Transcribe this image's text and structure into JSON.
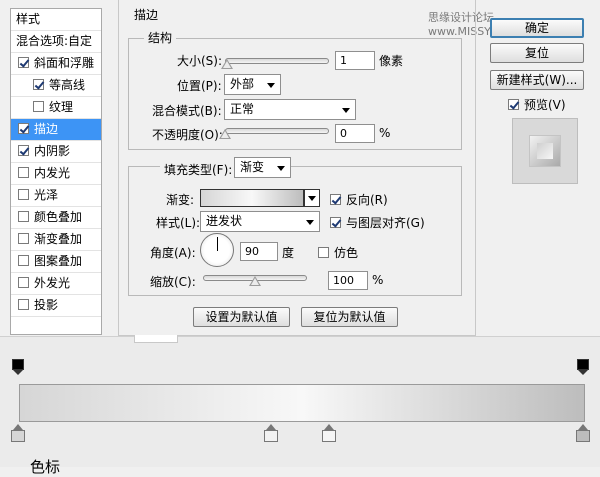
{
  "watermark": "思缘设计论坛 www.MISSYUAN.COM",
  "style_list": {
    "header": "样式",
    "blend_options": "混合选项:自定",
    "items": [
      {
        "label": "斜面和浮雕",
        "checked": true
      },
      {
        "label": "等高线",
        "checked": true
      },
      {
        "label": "纹理",
        "checked": false
      },
      {
        "label": "描边",
        "checked": true
      },
      {
        "label": "内阴影",
        "checked": true
      },
      {
        "label": "内发光",
        "checked": false
      },
      {
        "label": "光泽",
        "checked": false
      },
      {
        "label": "颜色叠加",
        "checked": false
      },
      {
        "label": "渐变叠加",
        "checked": false
      },
      {
        "label": "图案叠加",
        "checked": false
      },
      {
        "label": "外发光",
        "checked": false
      },
      {
        "label": "投影",
        "checked": false
      }
    ]
  },
  "stroke": {
    "title": "描边",
    "structure": {
      "title": "结构",
      "size_label": "大小(S):",
      "size_value": "1",
      "size_unit": "像素",
      "size_level": 0.02,
      "position_label": "位置(P):",
      "position_value": "外部",
      "blend_label": "混合模式(B):",
      "blend_value": "正常",
      "opacity_label": "不透明度(O):",
      "opacity_value": "0",
      "opacity_unit": "%",
      "opacity_level": 0.0
    },
    "fill": {
      "type_label": "填充类型(F):",
      "type_value": "渐变",
      "gradient_label": "渐变:",
      "reverse_label": "反向(R)",
      "reverse_checked": true,
      "style_label": "样式(L):",
      "style_value": "迸发状",
      "align_label": "与图层对齐(G)",
      "align_checked": true,
      "angle_label": "角度(A):",
      "angle_value": "90",
      "angle_unit": "度",
      "dither_label": "仿色",
      "dither_checked": false,
      "scale_label": "缩放(C):",
      "scale_value": "100",
      "scale_unit": "%",
      "scale_level": 0.5
    },
    "make_default": "设置为默认值",
    "reset_default": "复位为默认值"
  },
  "right_panel": {
    "ok": "确定",
    "reset": "复位",
    "new_style": "新建样式(W)...",
    "preview_label": "预览(V)",
    "preview_checked": true
  },
  "gradient_editor": {
    "label": "色标"
  }
}
